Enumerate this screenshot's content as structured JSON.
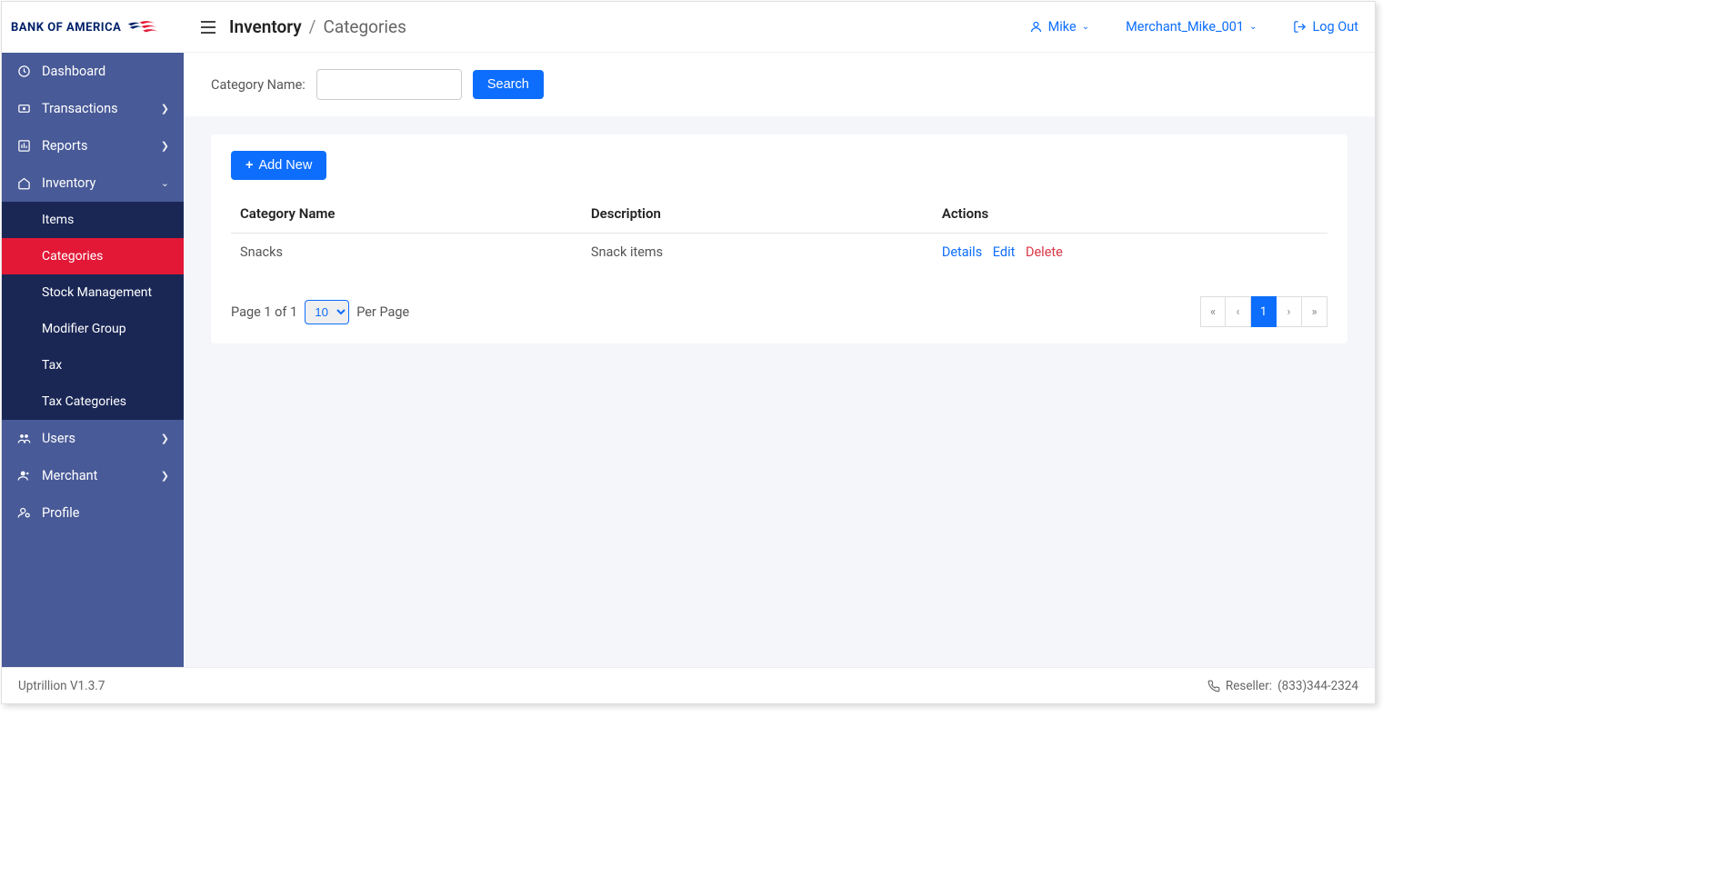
{
  "brand": "BANK OF AMERICA",
  "header": {
    "breadcrumb_main": "Inventory",
    "breadcrumb_sep": "/",
    "breadcrumb_sub": "Categories",
    "user": "Mike",
    "merchant": "Merchant_Mike_001",
    "logout": "Log Out"
  },
  "sidebar": {
    "items": [
      {
        "label": "Dashboard",
        "icon": "clock"
      },
      {
        "label": "Transactions",
        "icon": "money",
        "expandable": true
      },
      {
        "label": "Reports",
        "icon": "chart",
        "expandable": true
      },
      {
        "label": "Inventory",
        "icon": "home",
        "expanded": true
      },
      {
        "label": "Users",
        "icon": "users",
        "expandable": true
      },
      {
        "label": "Merchant",
        "icon": "user-plus",
        "expandable": true
      },
      {
        "label": "Profile",
        "icon": "user-gear"
      }
    ],
    "inventory_sub": [
      {
        "label": "Items"
      },
      {
        "label": "Categories",
        "active": true
      },
      {
        "label": "Stock Management"
      },
      {
        "label": "Modifier Group"
      },
      {
        "label": "Tax"
      },
      {
        "label": "Tax Categories"
      }
    ]
  },
  "filter": {
    "label": "Category Name:",
    "value": "",
    "search_btn": "Search"
  },
  "add_button": "Add New",
  "table": {
    "columns": [
      "Category Name",
      "Description",
      "Actions"
    ],
    "rows": [
      {
        "name": "Snacks",
        "description": "Snack items"
      }
    ],
    "actions": {
      "details": "Details",
      "edit": "Edit",
      "delete": "Delete"
    }
  },
  "pagination": {
    "page_text": "Page 1 of 1",
    "per_page_label": "Per Page",
    "page_size": "10",
    "current": "1"
  },
  "footer": {
    "version": "Uptrillion V1.3.7",
    "reseller_label": "Reseller:",
    "reseller_phone": "(833)344-2324"
  }
}
